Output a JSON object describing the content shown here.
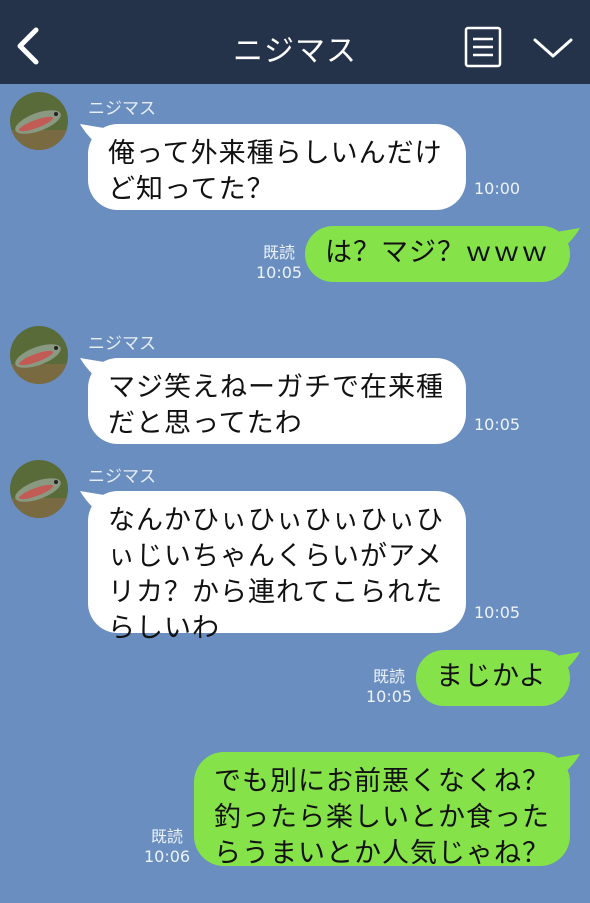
{
  "header": {
    "title": "ニジマス",
    "back_icon": "chevron-left-icon",
    "menu_icon": "menu-list-icon",
    "collapse_icon": "chevron-down-icon"
  },
  "colors": {
    "header_bg": "#24324a",
    "chat_bg": "#6a8ebf",
    "incoming_bubble": "#ffffff",
    "outgoing_bubble": "#85e249"
  },
  "messages": [
    {
      "direction": "in",
      "sender": "ニジマス",
      "text": "俺って外来種らしいんだけ\nど知ってた？",
      "time": "10:00"
    },
    {
      "direction": "out",
      "read": "既読",
      "text": "は？マジ？ｗｗｗ",
      "time": "10:05"
    },
    {
      "direction": "in",
      "sender": "ニジマス",
      "text": "マジ笑えねーガチで在来種\nだと思ってたわ",
      "time": "10:05"
    },
    {
      "direction": "in",
      "sender": "ニジマス",
      "text": "なんかひぃひぃひぃひぃひ\nぃじいちゃんくらいがアメ\nリカ？から連れてこられた\nらしいわ",
      "time": "10:05"
    },
    {
      "direction": "out",
      "read": "既読",
      "text": "まじかよ",
      "time": "10:05"
    },
    {
      "direction": "out",
      "read": "既読",
      "text": "でも別にお前悪くなくね？\n釣ったら楽しいとか食った\nらうまいとか人気じゃね？",
      "time": "10:06"
    }
  ]
}
